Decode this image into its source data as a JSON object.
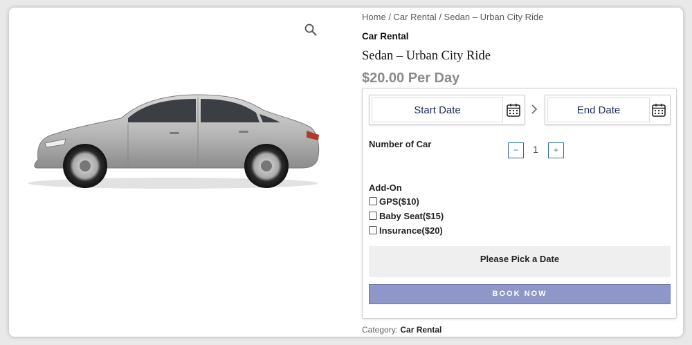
{
  "breadcrumb": {
    "items": [
      "Home",
      "Car Rental",
      "Sedan – Urban City Ride"
    ],
    "separator": "/"
  },
  "product": {
    "category_top": "Car Rental",
    "title": "Sedan – Urban City Ride",
    "price": "$20.00 Per Day",
    "image": "silver-sedan-car-image"
  },
  "booking": {
    "start_date_label": "Start Date",
    "end_date_label": "End Date",
    "number_label": "Number of Car",
    "quantity": "1",
    "minus_label": "−",
    "plus_label": "+",
    "addon_label": "Add-On",
    "addons": [
      {
        "label": "GPS($10)",
        "checked": false
      },
      {
        "label": "Baby Seat($15)",
        "checked": false
      },
      {
        "label": "Insurance($20)",
        "checked": false
      }
    ],
    "message": "Please Pick a Date",
    "book_label": "BOOK NOW"
  },
  "footer": {
    "category_prefix": "Category:",
    "category_value": "Car Rental"
  },
  "icons": {
    "zoom": "magnifier-icon",
    "calendar": "calendar-icon",
    "chevron": "chevron-right-icon"
  },
  "colors": {
    "accent_button": "#8e97c7",
    "date_text": "#1d2a5a",
    "qty_border": "#2f6f9a",
    "price": "#8a8a8a"
  }
}
